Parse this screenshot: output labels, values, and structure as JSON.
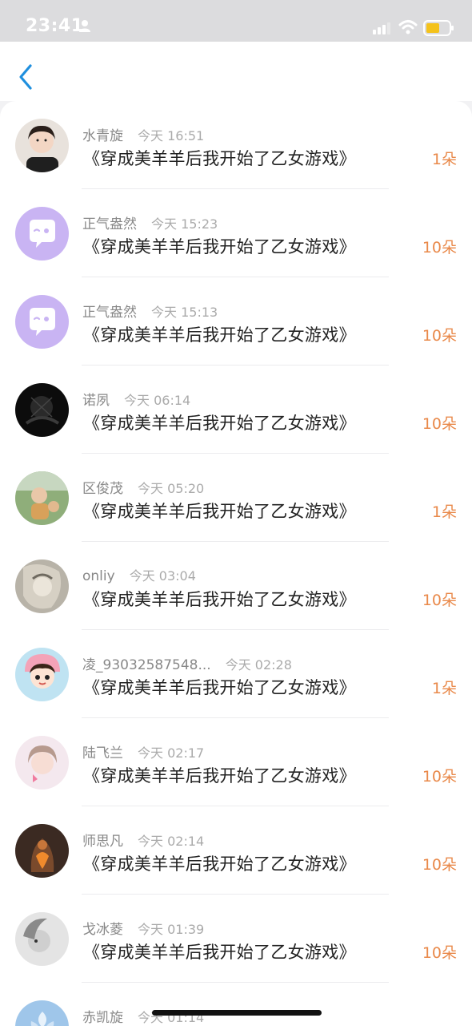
{
  "status_bar": {
    "time": "23:41"
  },
  "list": [
    {
      "username": "水青旋",
      "time": "今天 16:51",
      "title": "《穿成美羊羊后我开始了乙女游戏》",
      "amount": "1朵",
      "avatar": "avatar-photo-child"
    },
    {
      "username": "正气盎然",
      "time": "今天 15:23",
      "title": "《穿成美羊羊后我开始了乙女游戏》",
      "amount": "10朵",
      "avatar": "default-chat-avatar"
    },
    {
      "username": "正气盎然",
      "time": "今天 15:13",
      "title": "《穿成美羊羊后我开始了乙女游戏》",
      "amount": "10朵",
      "avatar": "default-chat-avatar"
    },
    {
      "username": "诺夙",
      "time": "今天 06:14",
      "title": "《穿成美羊羊后我开始了乙女游戏》",
      "amount": "10朵",
      "avatar": "avatar-photo-dark"
    },
    {
      "username": "区俊茂",
      "time": "今天 05:20",
      "title": "《穿成美羊羊后我开始了乙女游戏》",
      "amount": "1朵",
      "avatar": "avatar-photo-outdoor"
    },
    {
      "username": "onliy",
      "time": "今天 03:04",
      "title": "《穿成美羊羊后我开始了乙女游戏》",
      "amount": "10朵",
      "avatar": "avatar-photo-art"
    },
    {
      "username": "凌_93032587548...",
      "time": "今天 02:28",
      "title": "《穿成美羊羊后我开始了乙女游戏》",
      "amount": "1朵",
      "avatar": "avatar-cartoon-girl"
    },
    {
      "username": "陆飞兰",
      "time": "今天 02:17",
      "title": "《穿成美羊羊后我开始了乙女游戏》",
      "amount": "10朵",
      "avatar": "avatar-photo-pink"
    },
    {
      "username": "师思凡",
      "time": "今天 02:14",
      "title": "《穿成美羊羊后我开始了乙女游戏》",
      "amount": "10朵",
      "avatar": "avatar-photo-fire"
    },
    {
      "username": "戈冰菱",
      "time": "今天 01:39",
      "title": "《穿成美羊羊后我开始了乙女游戏》",
      "amount": "10朵",
      "avatar": "avatar-photo-grey"
    },
    {
      "username": "赤凯旋",
      "time": "今天 01:14",
      "title": "",
      "amount": "",
      "avatar": "avatar-photo-blue"
    }
  ],
  "colors": {
    "accent": "#1f8fde",
    "amount": "#e9894a",
    "default_avatar": "#c9b4f3"
  }
}
